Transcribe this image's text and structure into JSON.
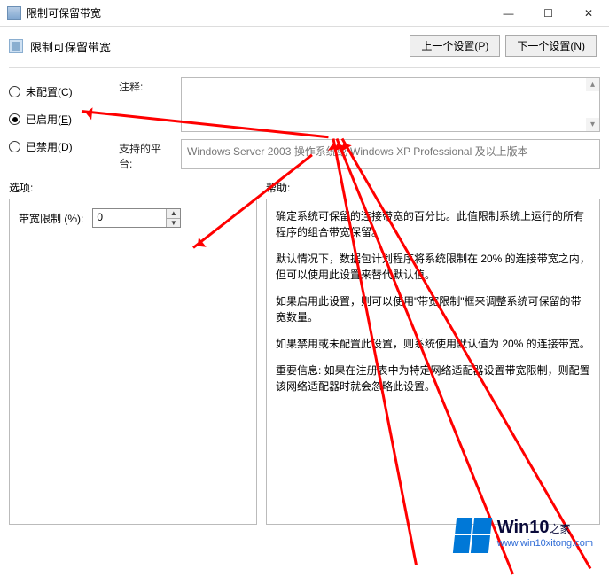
{
  "window": {
    "title": "限制可保留带宽",
    "minimize": "—",
    "maximize": "☐",
    "close": "✕"
  },
  "sub": {
    "label": "限制可保留带宽",
    "prev_btn": "上一个设置(",
    "prev_key": "P",
    "prev_btn_end": ")",
    "next_btn": "下一个设置(",
    "next_key": "N",
    "next_btn_end": ")"
  },
  "radios": {
    "not_configured": "未配置(",
    "not_configured_key": "C",
    "not_configured_end": ")",
    "enabled": "已启用(",
    "enabled_key": "E",
    "enabled_end": ")",
    "disabled": "已禁用(",
    "disabled_key": "D",
    "disabled_end": ")"
  },
  "labels": {
    "comment": "注释:",
    "platform": "支持的平台:",
    "options": "选项:",
    "help": "帮助:"
  },
  "platform_text": "Windows Server 2003 操作系统或 Windows XP Professional 及以上版本",
  "options": {
    "bandwidth_label": "带宽限制 (%):",
    "bandwidth_value": "0"
  },
  "help": {
    "p1": "确定系统可保留的连接带宽的百分比。此值限制系统上运行的所有程序的组合带宽保留。",
    "p2": "默认情况下，数据包计划程序将系统限制在 20% 的连接带宽之内，但可以使用此设置来替代默认值。",
    "p3": "如果启用此设置，则可以使用\"带宽限制\"框来调整系统可保留的带宽数量。",
    "p4": "如果禁用或未配置此设置，则系统使用默认值为 20% 的连接带宽。",
    "p5": "重要信息: 如果在注册表中为特定网络适配器设置带宽限制，则配置该网络适配器时就会忽略此设置。"
  },
  "watermark": {
    "brand": "Win10",
    "suffix": "之家",
    "site": "www.win10xitong.com"
  }
}
